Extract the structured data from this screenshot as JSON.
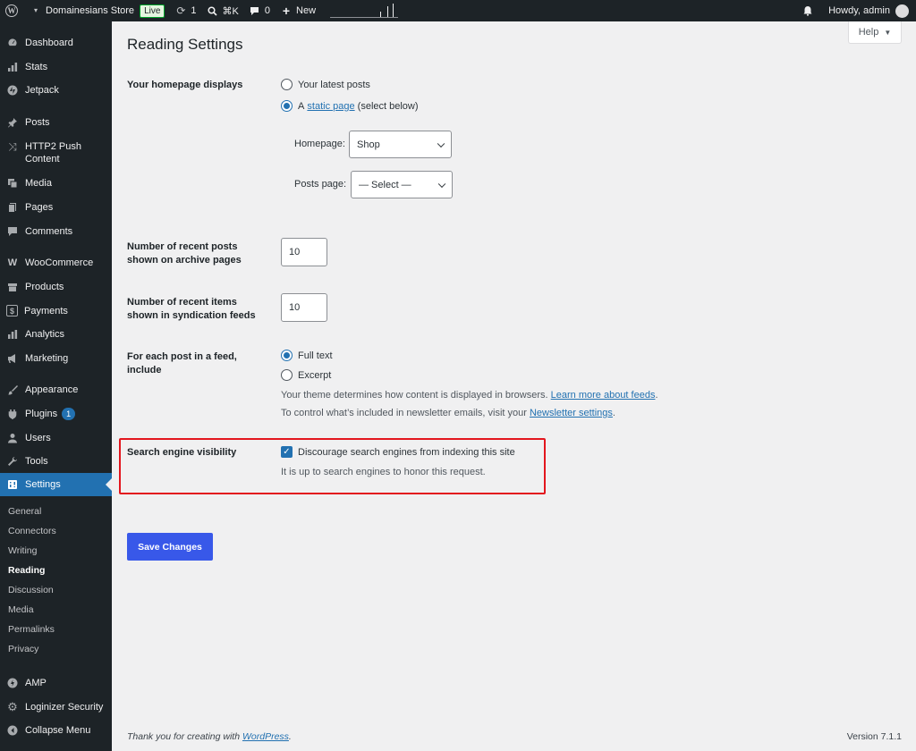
{
  "adminbar": {
    "site_name": "Domainesians Store",
    "live_badge": "Live",
    "updates_count": "1",
    "search_shortcut": "⌘K",
    "comments_count": "0",
    "new_label": "New",
    "howdy": "Howdy, admin"
  },
  "sidebar": {
    "items": [
      {
        "label": "Dashboard",
        "icon": "dashboard-icon"
      },
      {
        "label": "Stats",
        "icon": "stats-icon"
      },
      {
        "label": "Jetpack",
        "icon": "jetpack-icon"
      },
      {
        "label": "Posts",
        "icon": "pin-icon"
      },
      {
        "label": "HTTP2 Push",
        "label2": "Content",
        "icon": "shuffle-icon"
      },
      {
        "label": "Media",
        "icon": "media-icon"
      },
      {
        "label": "Pages",
        "icon": "pages-icon"
      },
      {
        "label": "Comments",
        "icon": "comments-icon"
      },
      {
        "label": "WooCommerce",
        "icon": "woo-icon"
      },
      {
        "label": "Products",
        "icon": "products-icon"
      },
      {
        "label": "Payments",
        "icon": "payments-icon"
      },
      {
        "label": "Analytics",
        "icon": "analytics-icon"
      },
      {
        "label": "Marketing",
        "icon": "megaphone-icon"
      },
      {
        "label": "Appearance",
        "icon": "brush-icon"
      },
      {
        "label": "Plugins",
        "icon": "plugin-icon",
        "badge": "1"
      },
      {
        "label": "Users",
        "icon": "user-icon"
      },
      {
        "label": "Tools",
        "icon": "wrench-icon"
      },
      {
        "label": "Settings",
        "icon": "settings-icon"
      },
      {
        "label": "AMP",
        "icon": "amp-icon"
      },
      {
        "label": "Loginizer Security",
        "icon": "gear-icon"
      },
      {
        "label": "Collapse Menu",
        "icon": "collapse-icon"
      }
    ],
    "submenu": [
      "General",
      "Connectors",
      "Writing",
      "Reading",
      "Discussion",
      "Media",
      "Permalinks",
      "Privacy"
    ]
  },
  "help_label": "Help",
  "page_title": "Reading Settings",
  "homepage": {
    "label": "Your homepage displays",
    "option_latest": "Your latest posts",
    "option_static_prefix": "A",
    "option_static_link": "static page",
    "option_static_suffix": "(select below)",
    "selected": "static",
    "homepage_label": "Homepage:",
    "homepage_value": "Shop",
    "posts_page_label": "Posts page:",
    "posts_page_value": "— Select —"
  },
  "archive_posts": {
    "label_line1": "Number of recent posts",
    "label_line2": "shown on archive pages",
    "value": "10"
  },
  "syndication_items": {
    "label_line1": "Number of recent items",
    "label_line2": "shown in syndication feeds",
    "value": "10"
  },
  "feed": {
    "label_line1": "For each post in a feed,",
    "label_line2": "include",
    "option_full": "Full text",
    "option_excerpt": "Excerpt",
    "selected": "full",
    "desc1_text": "Your theme determines how content is displayed in browsers.",
    "desc1_link": "Learn more about feeds",
    "desc2_text": "To control what’s included in newsletter emails, visit your",
    "desc2_link": "Newsletter settings"
  },
  "search_visibility": {
    "label": "Search engine visibility",
    "checkbox_label": "Discourage search engines from indexing this site",
    "checked": true,
    "desc": "It is up to search engines to honor this request."
  },
  "save_label": "Save Changes",
  "footer": {
    "thanks_prefix": "Thank you for creating with",
    "thanks_link": "WordPress",
    "version": "Version 7.1.1"
  },
  "colors": {
    "accent": "#2271b1",
    "save_button": "#3858e9",
    "highlight": "#e3161e",
    "sidebar": "#1d2327"
  }
}
